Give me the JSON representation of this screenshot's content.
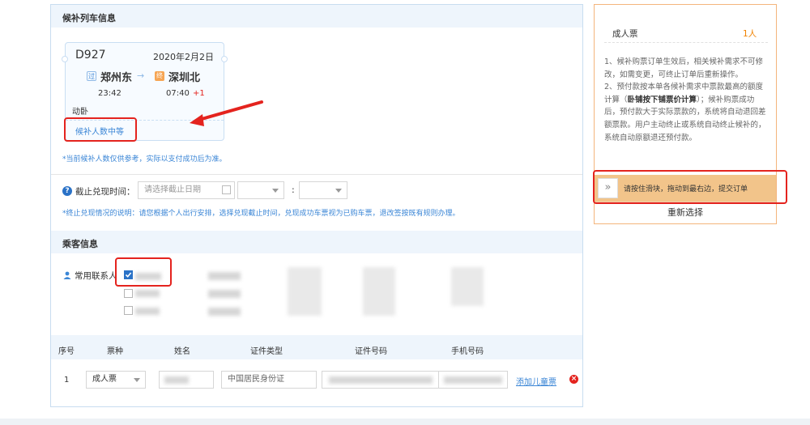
{
  "train_section": {
    "title": "候补列车信息",
    "train_no": "D927",
    "date": "2020年2月2日",
    "from_tag": "过",
    "from_station": "郑州东",
    "to_tag": "终",
    "to_station": "深圳北",
    "depart_time": "23:42",
    "arrive_time": "07:40",
    "arrive_offset": "+1",
    "seat_type": "动卧",
    "waitlist_status": "候补人数中等",
    "note": "*当前候补人数仅供参考，实际以支付成功后为准。"
  },
  "deadline": {
    "label": "截止兑现时间：",
    "date_placeholder": "请选择截止日期",
    "colon": ":",
    "note": "*终止兑现情况的说明：请您根据个人出行安排，选择兑现截止时间，兑现成功车票视为已购车票，退改签按既有规则办理。"
  },
  "passenger_section": {
    "title": "乘客信息",
    "contacts_label": "常用联系人"
  },
  "table": {
    "headers": [
      "序号",
      "票种",
      "姓名",
      "证件类型",
      "证件号码",
      "手机号码"
    ],
    "row": {
      "index": "1",
      "ticket_type": "成人票",
      "id_type": "中国居民身份证",
      "add_child_link": "添加儿童票"
    }
  },
  "side": {
    "ticket_label": "成人票",
    "ticket_count": "1人",
    "notes": [
      "1、候补购票订单生效后，相关候补需求不可修改，如需变更，可终止订单后重新操作。",
      "2、预付款按本单各候补需求中票款最高的额度计算（",
      "卧铺按下铺票价计算",
      "）；候补购票成功后，预付款大于实际票款的，系统将自动退回差额票款。用户主动终止或系统自动终止候补的，系统自动原额退还预付款。"
    ],
    "slider_icon": "»",
    "slider_text": "请按住滑块，拖动到最右边，提交订单",
    "reselect": "重新选择"
  },
  "colors": {
    "accent_blue": "#3b86d6",
    "arrive_red": "#e4231e",
    "slider_orange": "#f2c48a",
    "side_border": "#f4b57c",
    "ticket_count_orange": "#f08200"
  }
}
